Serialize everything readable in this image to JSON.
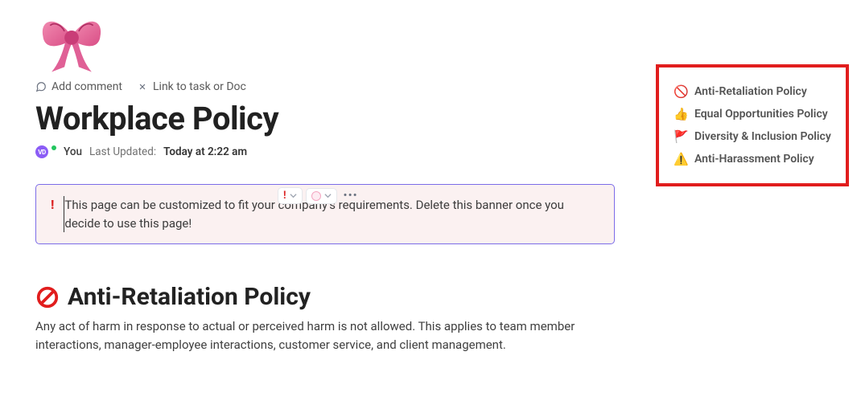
{
  "page": {
    "title": "Workplace Policy",
    "icon_name": "pink-bow"
  },
  "actions": {
    "add_comment": "Add comment",
    "link_task": "Link to task or Doc"
  },
  "meta": {
    "avatar_initials": "VD",
    "author_label": "You",
    "updated_prefix": "Last Updated:",
    "updated_time": "Today at 2:22 am"
  },
  "controls": {
    "priority_icon": "exclamation",
    "status_icon": "circle-outline",
    "more_icon": "dots"
  },
  "banner": {
    "icon": "exclamation",
    "text": "This page can be customized to fit your company's requirements. Delete this banner once you decide to use this page!"
  },
  "section_first": {
    "icon": "no-sign",
    "heading": "Anti-Retaliation Policy",
    "body": "Any act of harm in response to actual or perceived harm is not allowed. This applies to team member interactions, manager-employee interactions, customer service, and client management."
  },
  "outline": {
    "items": [
      {
        "emoji": "🚫",
        "label": "Anti-Retaliation Policy"
      },
      {
        "emoji": "👍",
        "label": "Equal Opportunities Policy"
      },
      {
        "emoji": "🚩",
        "label": "Diversity & Inclusion Policy"
      },
      {
        "emoji": "⚠️",
        "label": "Anti-Harassment Policy"
      }
    ]
  }
}
